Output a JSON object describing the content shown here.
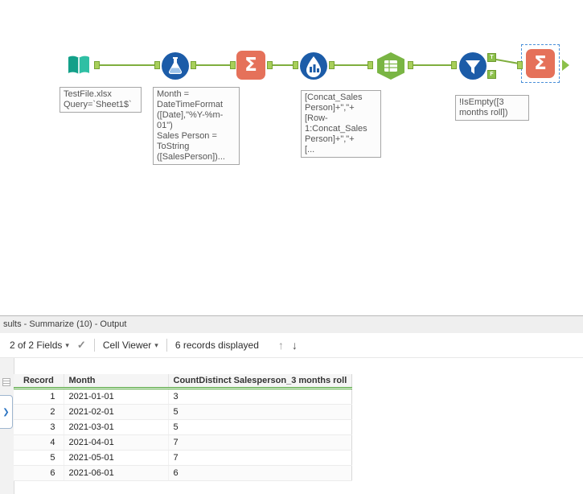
{
  "icons": {
    "sigma": "Σ",
    "caret": "▾",
    "check": "✓",
    "up_arrow": "↑",
    "down_arrow": "↓",
    "chevron_right": "❯",
    "t_label": "T",
    "f_label": "F"
  },
  "canvas": {
    "annotations": {
      "input": "TestFile.xlsx\nQuery=`Sheet1$`",
      "formula": "Month =\nDateTimeFormat\n([Date],\"%Y-%m-\n01\")\nSales Person =\nToString\n([SalesPerson])...",
      "multi_row": "[Concat_Sales\nPerson]+\",\"+\n[Row-\n1:Concat_Sales\nPerson]+\",\"+\n[...",
      "filter": "!IsEmpty([3\nmonths roll])"
    }
  },
  "results": {
    "title": "sults - Summarize (10) - Output",
    "toolbar": {
      "fields": "2 of 2 Fields",
      "cell_viewer": "Cell Viewer",
      "records": "6 records displayed"
    },
    "table": {
      "headers": [
        "Record",
        "Month",
        "CountDistinct Salesperson_3 months roll"
      ],
      "rows": [
        [
          "1",
          "2021-01-01",
          "3"
        ],
        [
          "2",
          "2021-02-01",
          "5"
        ],
        [
          "3",
          "2021-03-01",
          "5"
        ],
        [
          "4",
          "2021-04-01",
          "7"
        ],
        [
          "5",
          "2021-05-01",
          "7"
        ],
        [
          "6",
          "2021-06-01",
          "6"
        ]
      ]
    }
  }
}
